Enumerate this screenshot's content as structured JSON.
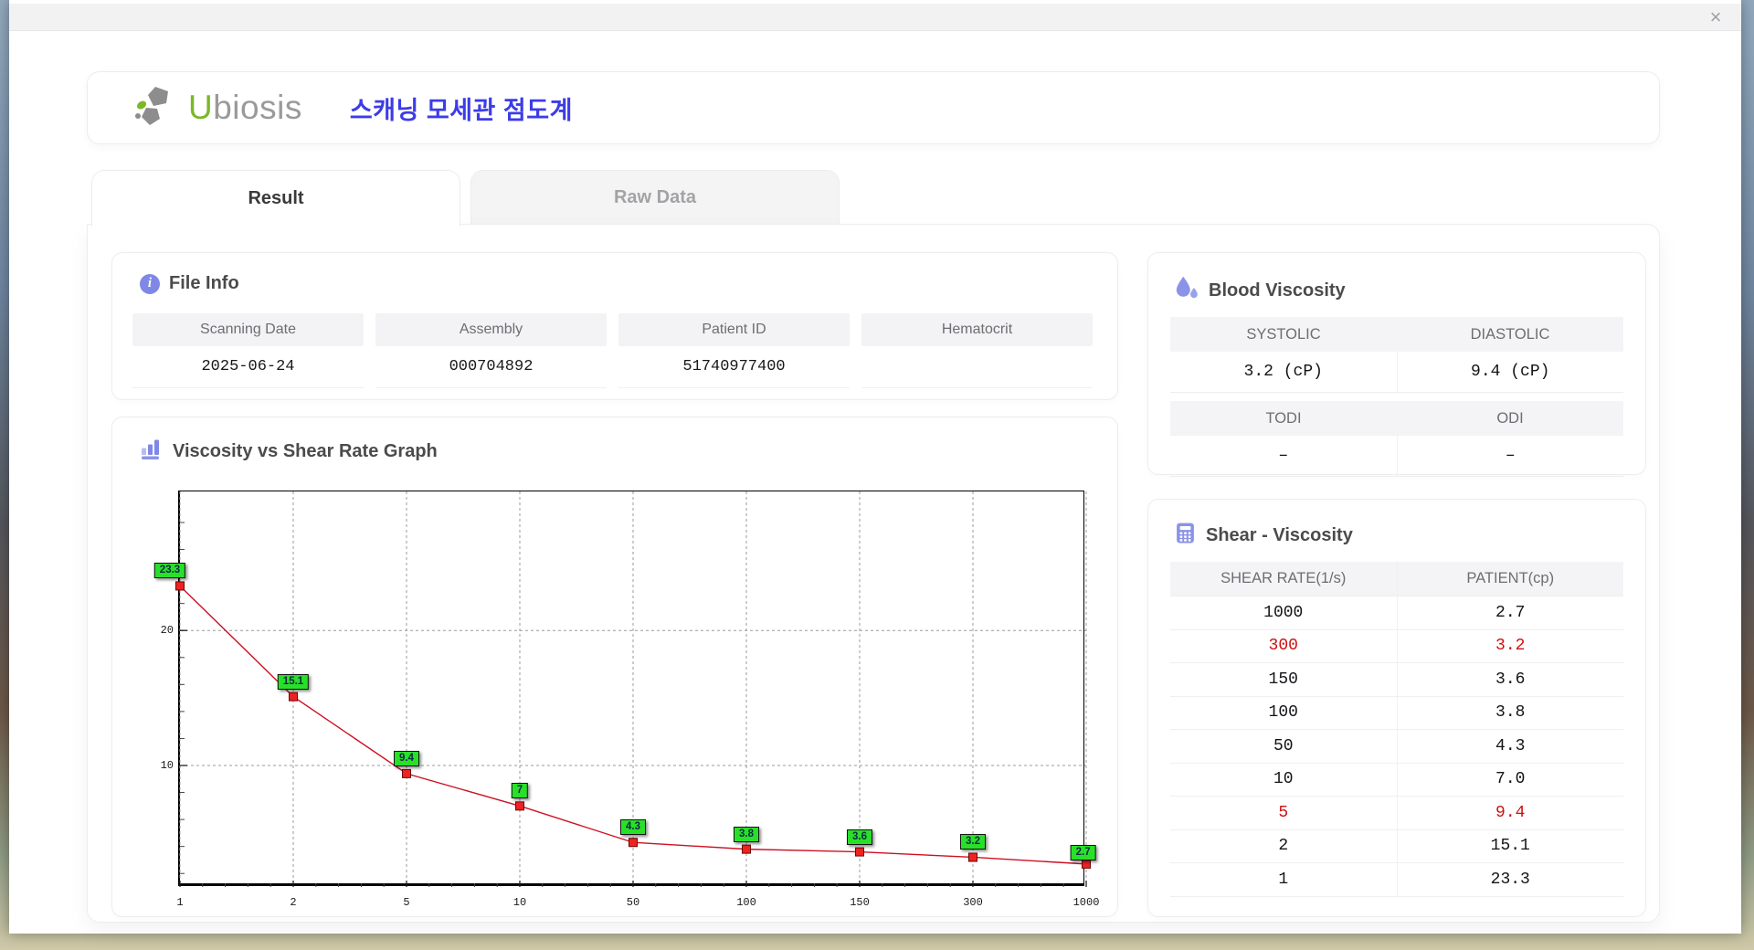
{
  "window": {
    "close_label": "×"
  },
  "header": {
    "logo_u": "U",
    "logo_rest": "biosis",
    "title_korean": "스캐닝 모세관 점도계"
  },
  "tabs": [
    {
      "label": "Result",
      "active": true
    },
    {
      "label": "Raw Data",
      "active": false
    }
  ],
  "file_info": {
    "heading": "File Info",
    "fields": [
      {
        "label": "Scanning Date",
        "value": "2025-06-24"
      },
      {
        "label": "Assembly",
        "value": "000704892"
      },
      {
        "label": "Patient ID",
        "value": "51740977400"
      },
      {
        "label": "Hematocrit",
        "value": ""
      }
    ]
  },
  "blood_viscosity": {
    "heading": "Blood Viscosity",
    "pairs": [
      {
        "label_a": "SYSTOLIC",
        "value_a": "3.2 (cP)",
        "label_b": "DIASTOLIC",
        "value_b": "9.4 (cP)"
      },
      {
        "label_a": "TODI",
        "value_a": "–",
        "label_b": "ODI",
        "value_b": "–"
      }
    ]
  },
  "graph": {
    "heading": "Viscosity vs Shear Rate Graph"
  },
  "chart_data": {
    "type": "line",
    "title": "Viscosity vs Shear Rate Graph",
    "categories": [
      "1",
      "2",
      "5",
      "10",
      "50",
      "100",
      "150",
      "300",
      "1000"
    ],
    "values": [
      23.3,
      15.1,
      9.4,
      7,
      4.3,
      3.8,
      3.6,
      3.2,
      2.7
    ],
    "point_labels": [
      "23.3",
      "15.1",
      "9.4",
      "7",
      "4.3",
      "3.8",
      "3.6",
      "3.2",
      "2.7"
    ],
    "xlabel": "",
    "ylabel": "",
    "x_scale": "categorical shear-rate steps (1/s), evenly spaced",
    "ylim": [
      1,
      30.3
    ],
    "yticks": [
      10,
      20
    ],
    "grid": true,
    "legend": "none",
    "line_color": "#cc1122",
    "marker_color": "#ee2222",
    "marker_border": "#6e0505",
    "label_bg": "#29e029"
  },
  "shear_table": {
    "heading": "Shear - Viscosity",
    "columns": [
      "SHEAR RATE(1/s)",
      "PATIENT(cp)"
    ],
    "rows": [
      {
        "shear": "1000",
        "patient": "2.7",
        "highlight": false
      },
      {
        "shear": "300",
        "patient": "3.2",
        "highlight": true
      },
      {
        "shear": "150",
        "patient": "3.6",
        "highlight": false
      },
      {
        "shear": "100",
        "patient": "3.8",
        "highlight": false
      },
      {
        "shear": "50",
        "patient": "4.3",
        "highlight": false
      },
      {
        "shear": "10",
        "patient": "7.0",
        "highlight": false
      },
      {
        "shear": "5",
        "patient": "9.4",
        "highlight": true
      },
      {
        "shear": "2",
        "patient": "15.1",
        "highlight": false
      },
      {
        "shear": "1",
        "patient": "23.3",
        "highlight": false
      }
    ]
  },
  "colors": {
    "accent_periwinkle": "#7f88e6",
    "korean_title_blue": "#3c3ce6",
    "logo_green": "#7cb829",
    "logo_gray": "#9a9a9a",
    "highlight_red": "#cc1111",
    "header_bg_gray": "#f4f4f6"
  }
}
